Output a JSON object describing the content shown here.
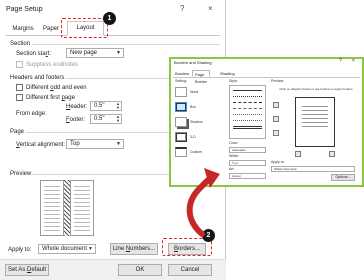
{
  "page_setup": {
    "title": "Page Setup",
    "help_glyph": "?",
    "close_glyph": "×",
    "tabs": [
      "Margins",
      "Paper",
      "Layout"
    ],
    "selected_tab": "Layout",
    "callout_1": "1",
    "section": {
      "heading": "Section",
      "start_label_pre": "Section sta",
      "start_label_key": "r",
      "start_label_post": "t:",
      "start_value": "New page",
      "suppress_label": "Suppress endnotes"
    },
    "headers_footers": {
      "heading": "Headers and footers",
      "odd_even_pre": "Different ",
      "odd_even_key": "o",
      "odd_even_post": "dd and even",
      "first_page_pre": "Different first ",
      "first_page_key": "p",
      "first_page_post": "age",
      "from_edge_label": "From edge:",
      "header_label_pre": "",
      "header_label_key": "H",
      "header_label_post": "eader:",
      "header_value": "0.5\"",
      "footer_label_pre": "",
      "footer_label_key": "F",
      "footer_label_post": "ooter:",
      "footer_value": "0.5\""
    },
    "page": {
      "heading": "Page",
      "valign_pre": "",
      "valign_key": "V",
      "valign_post": "ertical alignment:",
      "valign_value": "Top"
    },
    "preview": {
      "heading": "Preview"
    },
    "apply_to_label": "Apply to:",
    "apply_to_value": "Whole document",
    "line_numbers_pre": "Line ",
    "line_numbers_key": "N",
    "line_numbers_post": "umbers...",
    "borders_pre": "",
    "borders_key": "B",
    "borders_post": "orders...",
    "callout_2": "2",
    "set_default_pre": "Set As ",
    "set_default_key": "D",
    "set_default_post": "efault",
    "ok_label": "OK",
    "cancel_label": "Cancel"
  },
  "borders_shading": {
    "title": "Borders and Shading",
    "help_glyph": "?",
    "close_glyph": "×",
    "tabs": [
      "Borders",
      "Page Border",
      "Shading"
    ],
    "selected_tab": "Page Border",
    "setting_label": "Setting:",
    "settings": [
      "None",
      "Box",
      "Shadow",
      "3-D",
      "Custom"
    ],
    "style_label": "Style:",
    "color_label": "Color:",
    "color_value": "Automatic",
    "width_label": "Width:",
    "width_value": "½ pt",
    "art_label": "Art:",
    "art_value": "(none)",
    "preview_label": "Preview",
    "preview_hint": "Click on diagram below or use buttons to apply borders",
    "apply_label": "Apply to:",
    "apply_value": "Whole document",
    "options_label": "Options...",
    "ok_label": "OK",
    "cancel_label": "Cancel"
  },
  "colors": {
    "callout_dash": "#d8282a",
    "dialog_highlight": "#8dc63f",
    "arrow": "#c62828"
  }
}
